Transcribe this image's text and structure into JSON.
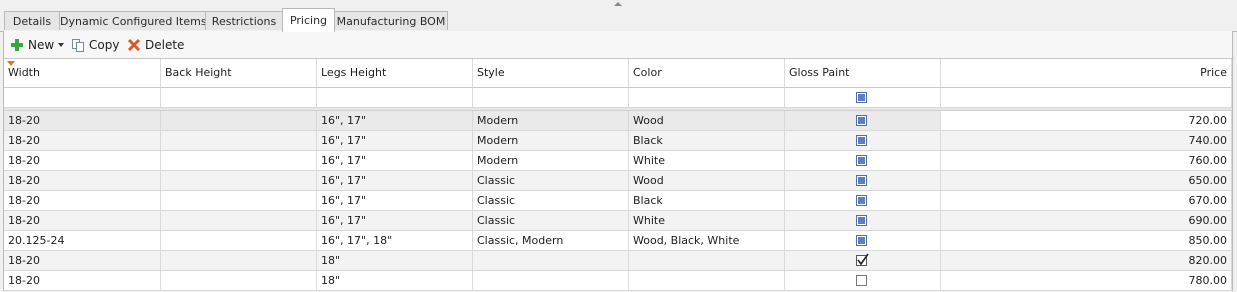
{
  "tabs": [
    {
      "label": "Details",
      "active": false
    },
    {
      "label": "Dynamic Configured Items",
      "active": false
    },
    {
      "label": "Restrictions",
      "active": false
    },
    {
      "label": "Pricing",
      "active": true
    },
    {
      "label": "Manufacturing BOM",
      "active": false
    }
  ],
  "toolbar": {
    "new_label": "New",
    "copy_label": "Copy",
    "delete_label": "Delete"
  },
  "columns": [
    "Width",
    "Back Height",
    "Legs Height",
    "Style",
    "Color",
    "Gloss Paint",
    "Price"
  ],
  "filter_row": {
    "gloss_paint": "indeterminate"
  },
  "rows": [
    {
      "width": "18-20",
      "back_height": "",
      "legs_height": "16\", 17\"",
      "style": "Modern",
      "color": "Wood",
      "gloss_paint": "indeterminate",
      "price": "720.00",
      "selected": true
    },
    {
      "width": "18-20",
      "back_height": "",
      "legs_height": "16\", 17\"",
      "style": "Modern",
      "color": "Black",
      "gloss_paint": "indeterminate",
      "price": "740.00"
    },
    {
      "width": "18-20",
      "back_height": "",
      "legs_height": "16\", 17\"",
      "style": "Modern",
      "color": "White",
      "gloss_paint": "indeterminate",
      "price": "760.00"
    },
    {
      "width": "18-20",
      "back_height": "",
      "legs_height": "16\", 17\"",
      "style": "Classic",
      "color": "Wood",
      "gloss_paint": "indeterminate",
      "price": "650.00"
    },
    {
      "width": "18-20",
      "back_height": "",
      "legs_height": "16\", 17\"",
      "style": "Classic",
      "color": "Black",
      "gloss_paint": "indeterminate",
      "price": "670.00"
    },
    {
      "width": "18-20",
      "back_height": "",
      "legs_height": "16\", 17\"",
      "style": "Classic",
      "color": "White",
      "gloss_paint": "indeterminate",
      "price": "690.00"
    },
    {
      "width": "20.125-24",
      "back_height": "",
      "legs_height": "16\", 17\", 18\"",
      "style": "Classic, Modern",
      "color": "Wood, Black, White",
      "gloss_paint": "indeterminate",
      "price": "850.00"
    },
    {
      "width": "18-20",
      "back_height": "",
      "legs_height": "18\"",
      "style": "",
      "color": "",
      "gloss_paint": "checked",
      "price": "820.00"
    },
    {
      "width": "18-20",
      "back_height": "",
      "legs_height": "18\"",
      "style": "",
      "color": "",
      "gloss_paint": "unchecked",
      "price": "780.00"
    }
  ],
  "icons": {
    "new": "add-plus-icon",
    "copy": "copy-icon",
    "delete": "delete-x-icon"
  },
  "colors": {
    "new_icon": "#3aa63a",
    "delete_icon": "#e0552a",
    "checkbox_fill": "#5b7fc1",
    "sort_indicator": "#e07a1f"
  }
}
